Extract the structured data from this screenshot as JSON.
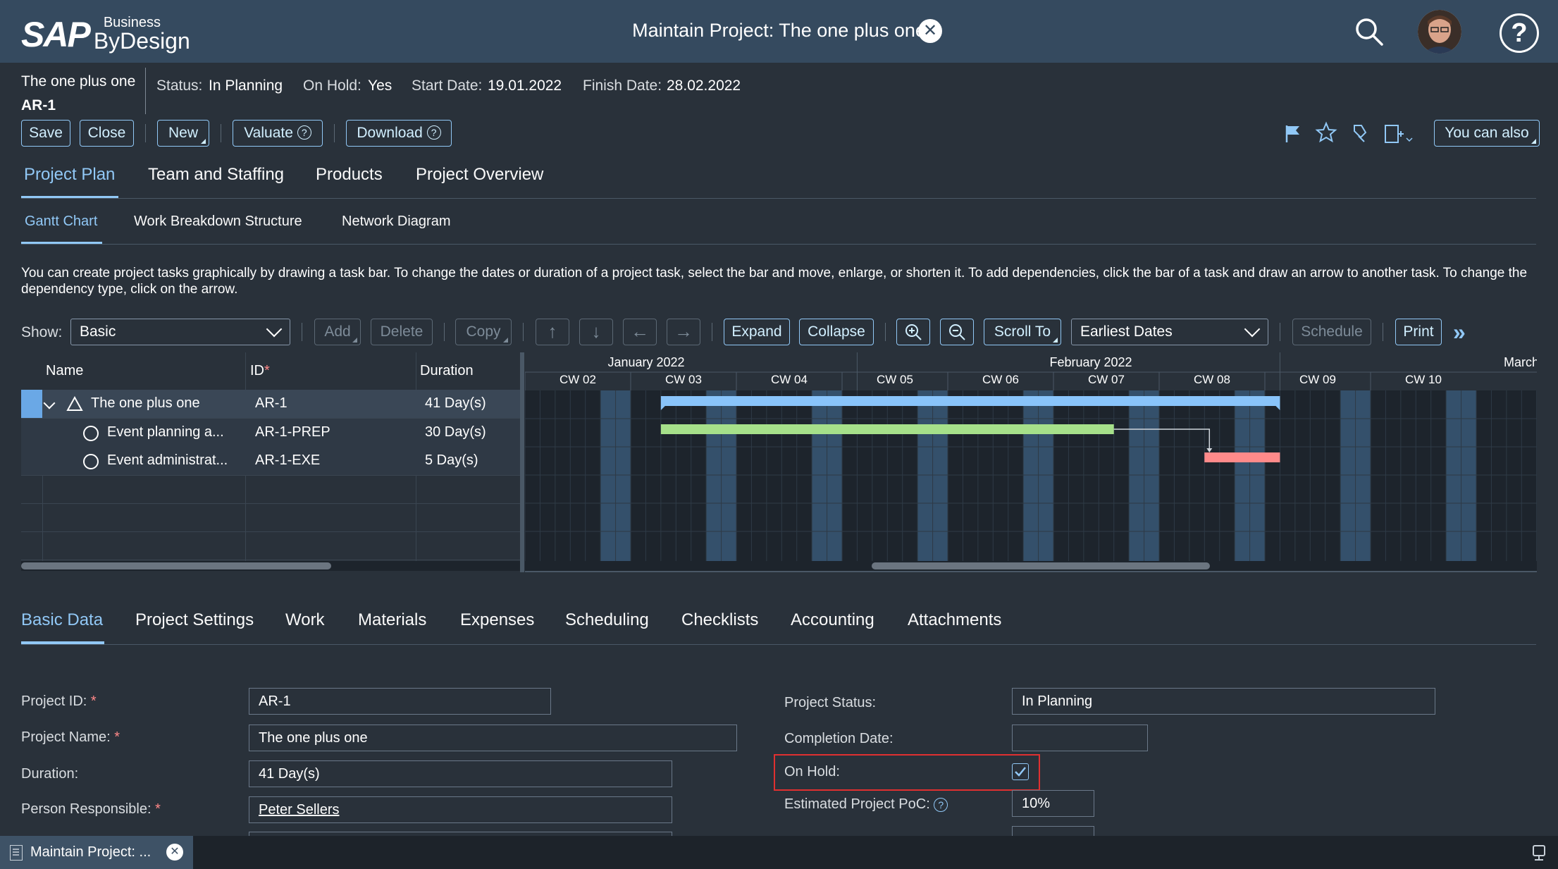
{
  "shell": {
    "brand": "SAP",
    "brand_sub1": "Business",
    "brand_sub2": "ByDesign",
    "title": "Maintain Project: The one plus one"
  },
  "header": {
    "project_name": "The one plus one",
    "project_id": "AR-1",
    "status_label": "Status:",
    "status_value": "In Planning",
    "onhold_label": "On Hold:",
    "onhold_value": "Yes",
    "start_label": "Start Date:",
    "start_value": "19.01.2022",
    "finish_label": "Finish Date:",
    "finish_value": "28.02.2022"
  },
  "toolbar": {
    "save": "Save",
    "close": "Close",
    "new": "New",
    "valuate": "Valuate",
    "download": "Download",
    "you_can_also": "You can also"
  },
  "tabs": [
    "Project Plan",
    "Team and Staffing",
    "Products",
    "Project Overview"
  ],
  "subtabs": [
    "Gantt Chart",
    "Work Breakdown Structure",
    "Network Diagram"
  ],
  "hint": "You can create project tasks graphically by drawing a task bar. To change the dates or duration of a project task, select the bar and move, enlarge, or shorten it. To add dependencies, click the bar of a task and draw an arrow to another task. To change the dependency type, click on the arrow.",
  "gantt_toolbar": {
    "show_label": "Show:",
    "show_value": "Basic",
    "add": "Add",
    "delete": "Delete",
    "copy": "Copy",
    "expand": "Expand",
    "collapse": "Collapse",
    "scroll_to": "Scroll To",
    "dates_value": "Earliest Dates",
    "schedule": "Schedule",
    "print": "Print"
  },
  "gantt_table": {
    "headers": [
      "Name",
      "ID",
      "Duration"
    ],
    "rows": [
      {
        "name": "The one plus one",
        "id": "AR-1",
        "duration": "41 Day(s)"
      },
      {
        "name": "Event planning a...",
        "id": "AR-1-PREP",
        "duration": "30 Day(s)"
      },
      {
        "name": "Event administrat...",
        "id": "AR-1-EXE",
        "duration": "5 Day(s)"
      }
    ]
  },
  "gantt_chart": {
    "months": [
      "January 2022",
      "February 2022",
      "March"
    ],
    "weeks": [
      "CW 02",
      "CW 03",
      "CW 04",
      "CW 05",
      "CW 06",
      "CW 07",
      "CW 08",
      "CW 09",
      "CW 10"
    ],
    "bars": [
      {
        "task": "The one plus one",
        "start": "19.01.2022",
        "finish": "28.02.2022",
        "color": "#89c4fa"
      },
      {
        "task": "Event planning a...",
        "start": "19.01.2022",
        "finish": "17.02.2022",
        "color": "#a6e08a"
      },
      {
        "task": "Event administrat...",
        "start": "24.02.2022",
        "finish": "28.02.2022",
        "color": "#ff8a8a"
      }
    ]
  },
  "detail_tabs": [
    "Basic Data",
    "Project Settings",
    "Work",
    "Materials",
    "Expenses",
    "Scheduling",
    "Checklists",
    "Accounting",
    "Attachments"
  ],
  "form": {
    "project_id_label": "Project ID:",
    "project_id_value": "AR-1",
    "project_name_label": "Project Name:",
    "project_name_value": "The one plus one",
    "duration_label": "Duration:",
    "duration_value": "41 Day(s)",
    "person_label": "Person Responsible:",
    "person_value": "Peter Sellers",
    "status_label": "Project Status:",
    "status_value": "In Planning",
    "completion_label": "Completion Date:",
    "completion_value": "",
    "onhold_label": "On Hold:",
    "onhold_checked": true,
    "poc_label": "Estimated Project PoC:",
    "poc_value": "10%"
  },
  "taskbar": {
    "item": "Maintain Project: ..."
  },
  "colors": {
    "shell": "#354a5f",
    "background": "#29313a",
    "accent": "#91c8f6",
    "highlight_box": "#e03030"
  }
}
